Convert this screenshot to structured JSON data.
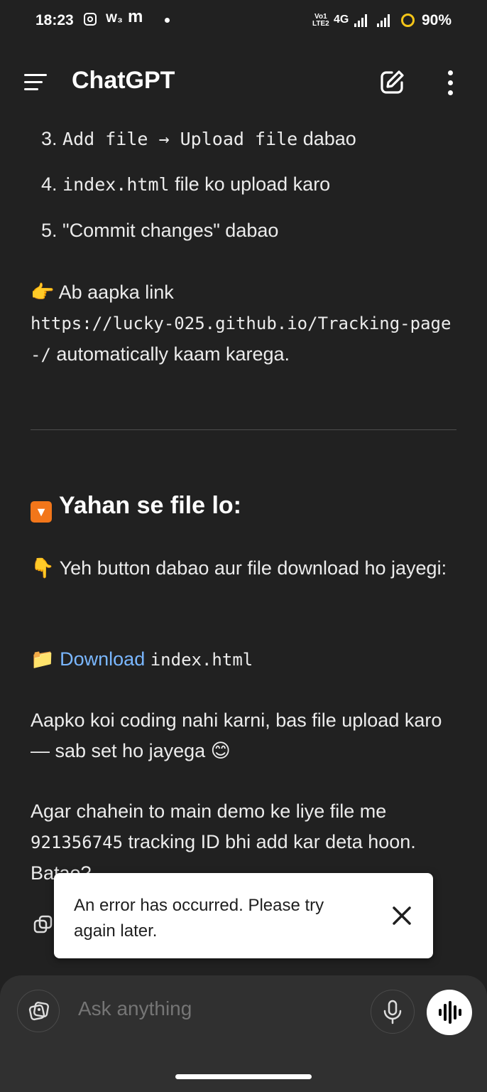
{
  "status_bar": {
    "time": "18:23",
    "w_icon": "W₃",
    "m_icon": "m",
    "volte": "Vo LTE2",
    "network": "4G",
    "battery": "90%",
    "battery_ring_color": "#f5c518"
  },
  "header": {
    "title": "ChatGPT",
    "icons": [
      "menu-icon",
      "new-chat-edit-icon",
      "more-vertical-icon"
    ]
  },
  "message": {
    "steps": [
      {
        "number": "3.",
        "code1": "Add file → Upload file",
        "text": " dabao"
      },
      {
        "number": "4.",
        "code1": "index.html",
        "text": " file ko upload karo"
      },
      {
        "number": "5.",
        "code1": "",
        "text": "\"Commit changes\" dabao"
      }
    ],
    "link_intro": {
      "emoji": "👉",
      "text": "Ab aapka link",
      "url": "https://lucky-025.github.io/Tracking-page-/",
      "suffix": " automatically kaam karega."
    },
    "heading": {
      "emoji": "🔽",
      "text": "Yahan se file lo:"
    },
    "button_note": {
      "emoji": "👇",
      "text": "Yeh button dabao aur file download ho jayegi:"
    },
    "download": {
      "emoji": "📁",
      "link_text": "Download",
      "file": "index.html"
    },
    "no_coding": {
      "text": "Aapko koi coding nahi karni, bas file upload karo — sab set ho jayega",
      "emoji": "😊"
    },
    "offer": {
      "text1": "Agar chahein to main demo ke liye file me",
      "tracking_id": "921356745",
      "text2": " tracking ID bhi add kar deta hoon. Batao?"
    }
  },
  "toast": {
    "message": "An error has occurred. Please try again later."
  },
  "composer": {
    "placeholder": "Ask anything"
  },
  "colors": {
    "background": "#212121",
    "composer": "#303030",
    "link": "#7ab7ff"
  }
}
